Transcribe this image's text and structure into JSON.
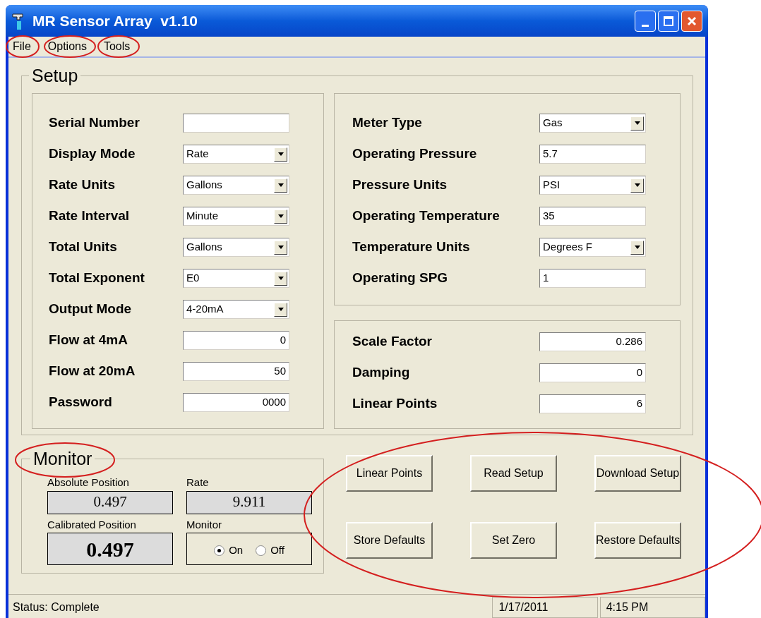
{
  "window": {
    "title": "MR Sensor Array  v1.10"
  },
  "menu": [
    {
      "label": "File"
    },
    {
      "label": "Options"
    },
    {
      "label": "Tools"
    }
  ],
  "setup": {
    "title": "Setup",
    "left_fields": [
      {
        "label": "Serial Number",
        "kind": "text"
      },
      {
        "label": "Display Mode",
        "kind": "dropdown",
        "value": "Rate"
      },
      {
        "label": "Rate Units",
        "kind": "dropdown",
        "value": "Gallons"
      },
      {
        "label": "Rate Interval",
        "kind": "dropdown",
        "value": "Minute"
      },
      {
        "label": "Total Units",
        "kind": "dropdown",
        "value": "Gallons"
      },
      {
        "label": "Total Exponent",
        "kind": "dropdown",
        "value": "E0"
      },
      {
        "label": "Output Mode",
        "kind": "dropdown",
        "value": "4-20mA"
      },
      {
        "label": "Flow at 4mA",
        "kind": "number",
        "value": "0"
      },
      {
        "label": "Flow at 20mA",
        "kind": "number",
        "value": "50"
      },
      {
        "label": "Password",
        "kind": "number",
        "value": "0000"
      }
    ],
    "meter_fields": [
      {
        "label": "Meter Type",
        "kind": "dropdown",
        "value": "Gas"
      },
      {
        "label": "Operating Pressure",
        "kind": "text",
        "value": "5.7"
      },
      {
        "label": "Pressure Units",
        "kind": "dropdown",
        "value": "PSI"
      },
      {
        "label": "Operating Temperature",
        "kind": "text",
        "value": "35"
      },
      {
        "label": "Temperature Units",
        "kind": "dropdown",
        "value": "Degrees F"
      },
      {
        "label": "Operating SPG",
        "kind": "text",
        "value": "1"
      }
    ],
    "scale_fields": [
      {
        "label": "Scale Factor",
        "kind": "number",
        "value": "0.286"
      },
      {
        "label": "Damping",
        "kind": "number",
        "value": "0"
      },
      {
        "label": "Linear Points",
        "kind": "number",
        "value": "6"
      }
    ]
  },
  "monitor": {
    "title": "Monitor",
    "absolute_label": "Absolute Position",
    "absolute_value": "0.497",
    "rate_label": "Rate",
    "rate_value": "9.911",
    "calibrated_label": "Calibrated Position",
    "calibrated_value": "0.497",
    "monitor_label": "Monitor",
    "options": [
      {
        "label": "On",
        "selected": true
      },
      {
        "label": "Off",
        "selected": false
      }
    ]
  },
  "buttons": [
    [
      "Linear Points",
      "Read Setup",
      "Download Setup"
    ],
    [
      "Store Defaults",
      "Set Zero",
      "Restore Defaults"
    ]
  ],
  "status_bar": {
    "status": "Status:  Complete",
    "date": "1/17/2011",
    "time": "4:15 PM"
  }
}
